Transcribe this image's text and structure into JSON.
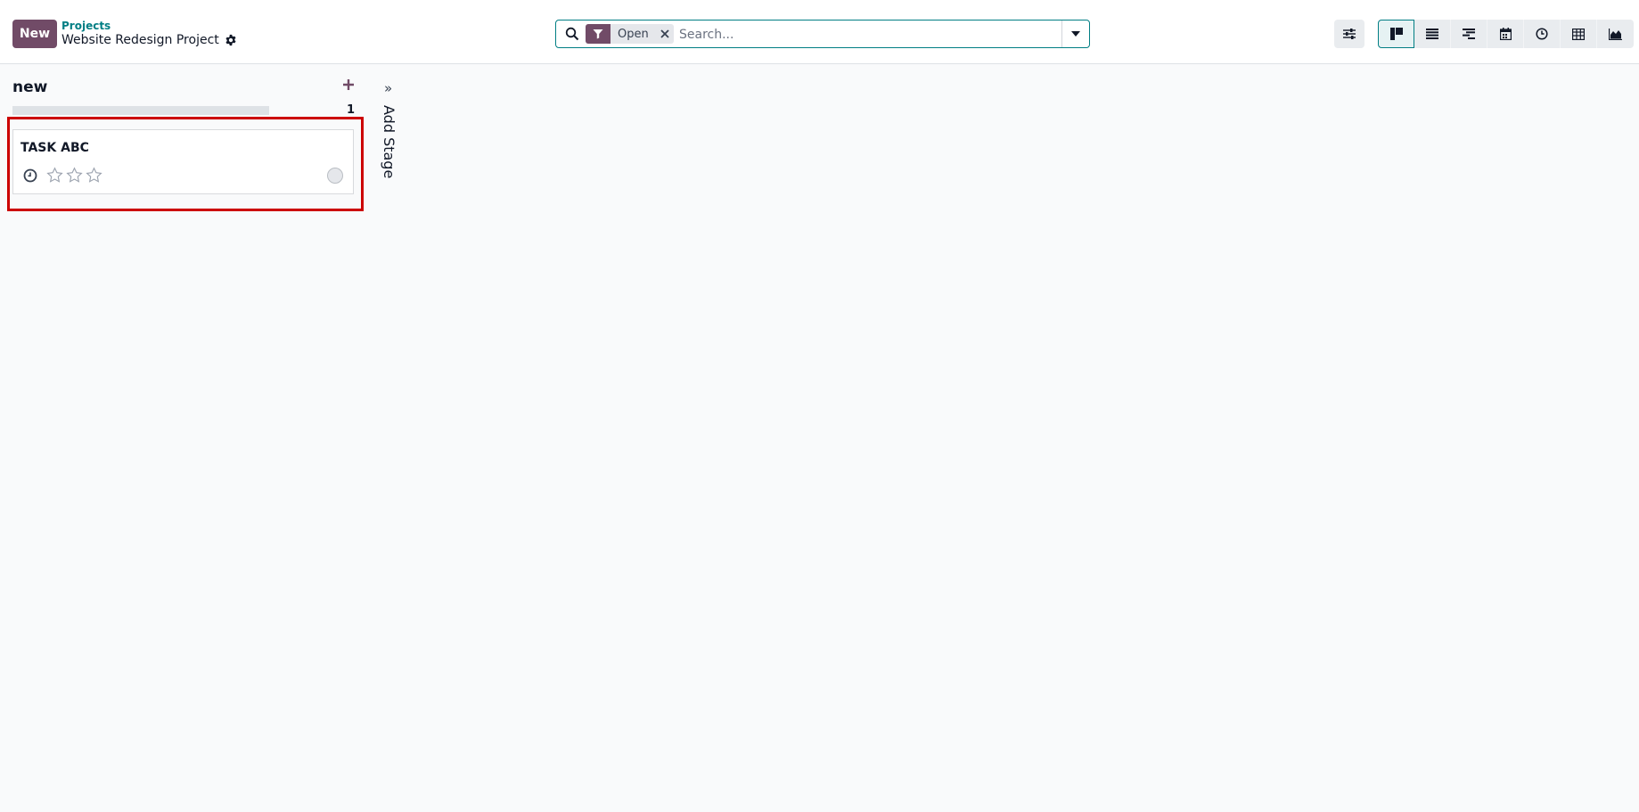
{
  "control_panel": {
    "new_button": "New",
    "breadcrumb_parent": "Projects",
    "breadcrumb_current": "Website Redesign Project"
  },
  "search": {
    "facet_label": "Open",
    "placeholder": "Search..."
  },
  "views": [
    {
      "name": "kanban",
      "active": true
    },
    {
      "name": "list",
      "active": false
    },
    {
      "name": "gantt",
      "active": false
    },
    {
      "name": "calendar",
      "active": false
    },
    {
      "name": "activity",
      "active": false
    },
    {
      "name": "pivot",
      "active": false
    },
    {
      "name": "graph",
      "active": false
    }
  ],
  "kanban": {
    "columns": [
      {
        "title": "new",
        "count": "1",
        "cards": [
          {
            "title": "TASK ABC",
            "priority_stars": 3,
            "state": "normal"
          }
        ]
      }
    ],
    "add_stage_label": "Add Stage",
    "add_stage_chevron": "»"
  },
  "colors": {
    "primary": "#714b67",
    "accent": "#017e84",
    "highlight_box": "#cc0000"
  },
  "icons": {
    "search": "search-icon",
    "filter": "filter-icon",
    "remove": "close-icon",
    "dropdown": "caret-down-icon",
    "settings": "gear-icon",
    "search_panel_toggle": "sliders-icon",
    "activity": "clock-icon",
    "priority": "star-icon"
  }
}
